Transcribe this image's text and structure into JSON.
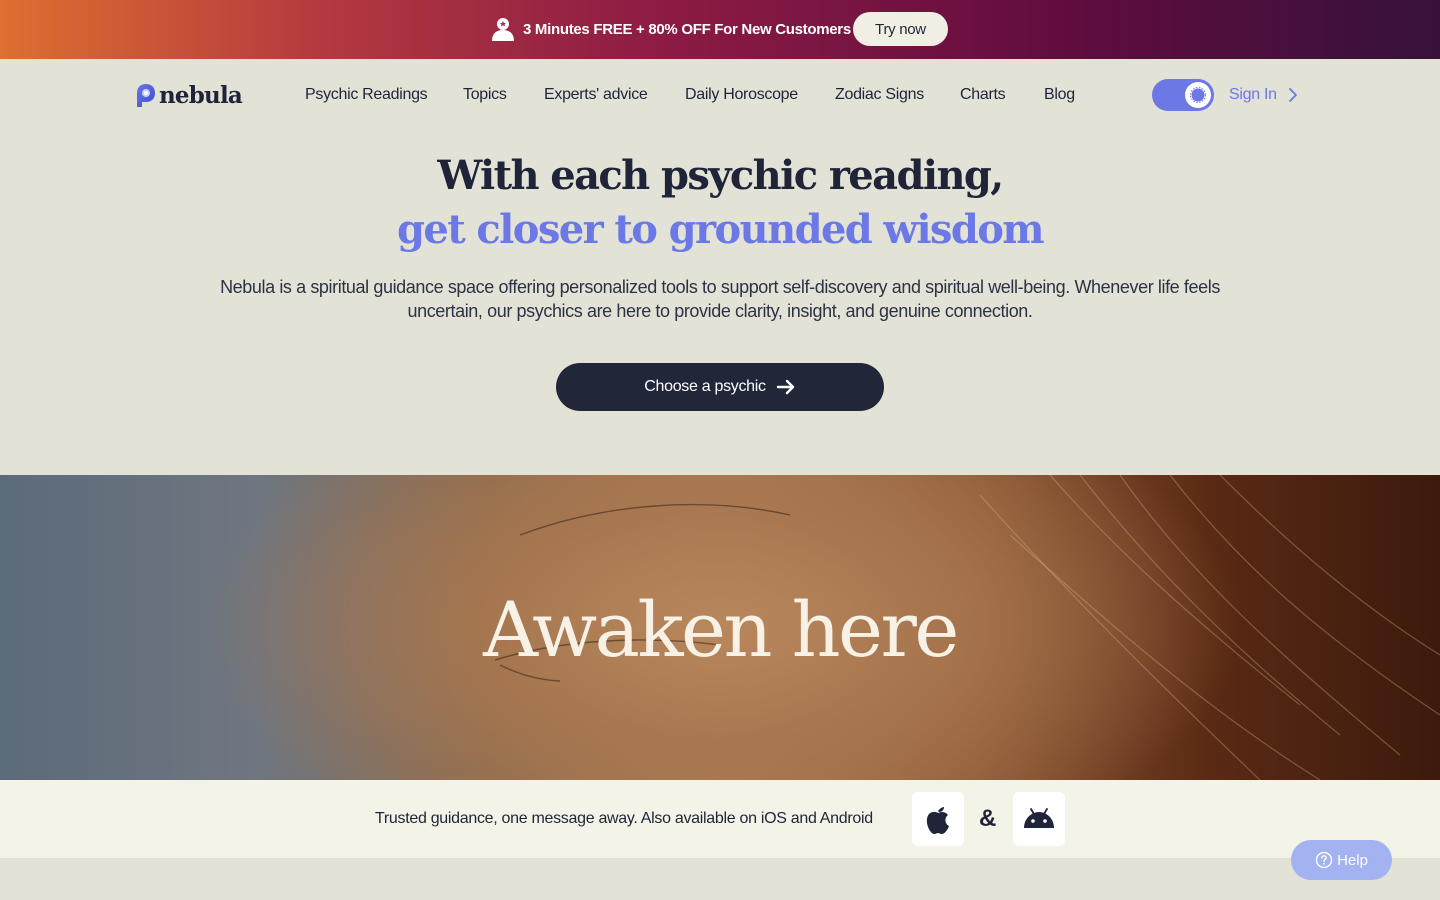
{
  "promo": {
    "text": "3 Minutes FREE + 80% OFF For New Customers",
    "button_label": "Try now",
    "icon": "user-gift-icon"
  },
  "header": {
    "logo_text": "nebula",
    "nav_items": [
      {
        "label": "Psychic Readings"
      },
      {
        "label": "Topics"
      },
      {
        "label": "Experts' advice"
      },
      {
        "label": "Daily Horoscope"
      },
      {
        "label": "Zodiac Signs"
      },
      {
        "label": "Charts"
      },
      {
        "label": "Blog"
      }
    ],
    "theme_toggle": {
      "state": "on",
      "icon": "sun-icon"
    },
    "signin_label": "Sign In"
  },
  "hero": {
    "title_line1": "With each psychic reading,",
    "title_line2": "get closer to grounded wisdom",
    "description": "Nebula is a spiritual guidance space offering personalized tools to support self-discovery and spiritual well-being. Whenever life feels uncertain, our psychics are here to provide clarity, insight, and genuine connection.",
    "cta_label": "Choose a psychic"
  },
  "banner": {
    "title": "Awaken here"
  },
  "apps": {
    "text": "Trusted guidance, one message away. Also available on iOS and Android",
    "separator": "&",
    "stores": [
      "apple-icon",
      "android-icon"
    ]
  },
  "help": {
    "label": "Help"
  },
  "colors": {
    "accent": "#6b78e6",
    "dark": "#212639",
    "background": "#e3e2d6"
  }
}
